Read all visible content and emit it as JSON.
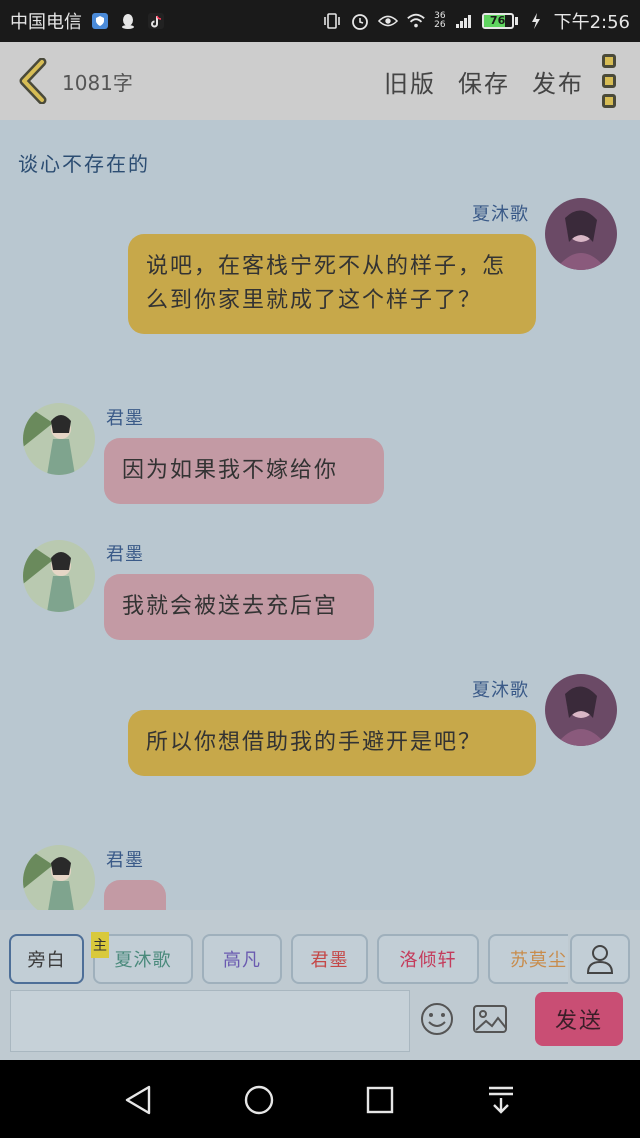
{
  "status_bar": {
    "carrier": "中国电信",
    "network_label": "36",
    "network_label_2": "26",
    "battery_level": "76",
    "battery_fraction": 0.76,
    "time": "下午2:56"
  },
  "toolbar": {
    "word_count": "1081字",
    "old_version": "旧版",
    "save": "保存",
    "publish": "发布"
  },
  "chat": {
    "title": "谈心不存在的",
    "messages": [
      {
        "speaker": "夏沐歌",
        "side": "right",
        "text": "说吧，在客栈宁死不从的样子，怎么到你家里就成了这个样子了？"
      },
      {
        "speaker": "君墨",
        "side": "left",
        "text": "因为如果我不嫁给你"
      },
      {
        "speaker": "君墨",
        "side": "left",
        "text": "我就会被送去充后宫"
      },
      {
        "speaker": "夏沐歌",
        "side": "right",
        "text": "所以你想借助我的手避开是吧？"
      },
      {
        "speaker": "君墨",
        "side": "left",
        "text": ""
      }
    ]
  },
  "characters": {
    "host_tag": "主",
    "items": [
      {
        "label": "旁白",
        "color": "#3a3a3a"
      },
      {
        "label": "夏沐歌",
        "color": "#4a8a7c"
      },
      {
        "label": "高凡",
        "color": "#6a5ab0"
      },
      {
        "label": "君墨",
        "color": "#c44848"
      },
      {
        "label": "洛倾轩",
        "color": "#c43c5c"
      },
      {
        "label": "苏莫尘",
        "color": "#c88c4c"
      }
    ]
  },
  "composer": {
    "placeholder": "",
    "send": "发送"
  },
  "colors": {
    "bubble_right": "#c7a84a",
    "bubble_left": "#c39aa4",
    "send": "#c94e74",
    "name": "#3a5a88"
  }
}
